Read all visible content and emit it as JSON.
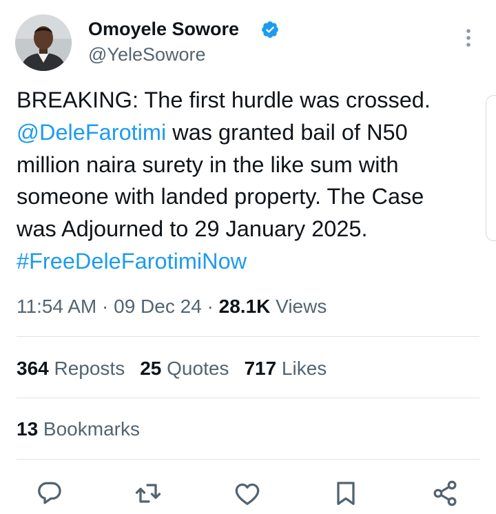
{
  "author": {
    "name": "Omoyele Sowore",
    "handle": "@YeleSowore",
    "verified": true
  },
  "tweet": {
    "lines": [
      [
        {
          "text": "BREAKING: The first hurdle was crossed.",
          "link": false
        }
      ],
      [
        {
          "text": "@DeleFarotimi",
          "link": true
        },
        {
          "text": " was granted bail of N50",
          "link": false
        }
      ],
      [
        {
          "text": "million naira surety in the like sum with",
          "link": false
        }
      ],
      [
        {
          "text": "someone with landed property. The Case",
          "link": false
        }
      ],
      [
        {
          "text": "was Adjourned to 29 January 2025.",
          "link": false
        }
      ],
      [
        {
          "text": "#FreeDeleFarotimiNow",
          "link": true
        }
      ]
    ]
  },
  "meta": {
    "time": "11:54 AM",
    "separator": " · ",
    "date": "09 Dec 24",
    "views_count": "28.1K",
    "views_label": " Views"
  },
  "stats": {
    "reposts_count": "364",
    "reposts_label": " Reposts",
    "quotes_count": "25",
    "quotes_label": " Quotes",
    "likes_count": "717",
    "likes_label": " Likes",
    "bookmarks_count": "13",
    "bookmarks_label": " Bookmarks"
  },
  "actions": [
    "reply-icon",
    "repost-icon",
    "like-icon",
    "bookmark-icon",
    "share-icon"
  ],
  "colors": {
    "link": "#1d9bf0",
    "verified": "#1d9bf0",
    "text": "#0f1419",
    "secondary": "#536471",
    "divider": "#dfe3e6"
  }
}
